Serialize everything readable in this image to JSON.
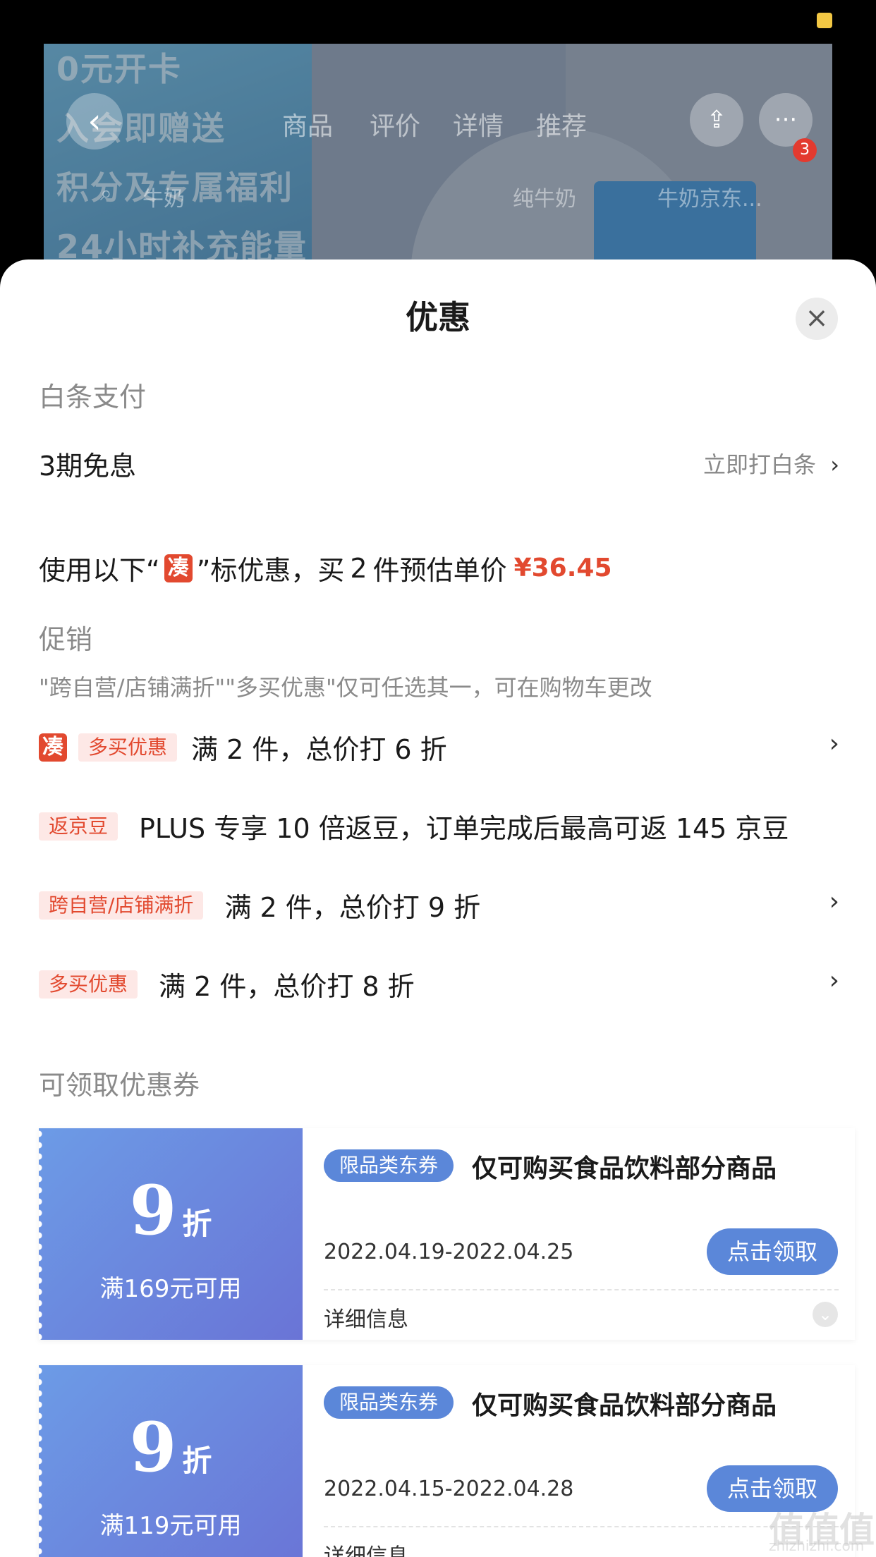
{
  "background": {
    "promo_lines": [
      "0元开卡",
      "入会即赠送",
      "积分及专属福利",
      "24小时补充能量"
    ],
    "tabs": [
      "商品",
      "评价",
      "详情",
      "推荐"
    ],
    "search_words": [
      "牛奶",
      "纯牛奶",
      "牛奶京东..."
    ],
    "more_badge": "3"
  },
  "sheet": {
    "title": "优惠",
    "close_icon": "close-icon",
    "baitiao": {
      "section_label": "白条支付",
      "plan": "3期免息",
      "action": "立即打白条"
    },
    "summary": {
      "prefix": "使用以下“",
      "tag": "凑",
      "middle": "”标优惠，买",
      "qty": "2",
      "suffix": "件预估单价",
      "price": "¥36.45"
    },
    "promotions": {
      "section_label": "促销",
      "note": "\"跨自营/店铺满折\"\"多买优惠\"仅可任选其一，可在购物车更改",
      "items": [
        {
          "cou": "凑",
          "tag": "多买优惠",
          "desc": "满 2 件，总价打 6 折",
          "has_arrow": true
        },
        {
          "tag": "返京豆",
          "desc": "PLUS 专享 10 倍返豆，订单完成后最高可返 145 京豆",
          "has_arrow": false
        },
        {
          "tag": "跨自营/店铺满折",
          "desc": "满 2 件，总价打 9 折",
          "has_arrow": true
        },
        {
          "tag": "多买优惠",
          "desc": "满 2 件，总价打 8 折",
          "has_arrow": true
        }
      ]
    },
    "coupons": {
      "section_label": "可领取优惠券",
      "items": [
        {
          "num": "9",
          "unit": "折",
          "condition": "满169元可用",
          "tag": "限品类东券",
          "title": "仅可购买食品饮料部分商品",
          "date": "2022.04.19-2022.04.25",
          "button": "点击领取",
          "detail": "详细信息"
        },
        {
          "num": "9",
          "unit": "折",
          "condition": "满119元可用",
          "tag": "限品类东券",
          "title": "仅可购买食品饮料部分商品",
          "date": "2022.04.15-2022.04.28",
          "button": "点击领取",
          "detail": "详细信息"
        }
      ]
    }
  },
  "watermark": {
    "text": "值值值",
    "sub": "zhizhizhi.com"
  },
  "colors": {
    "accent_red": "#e2492f",
    "coupon_blue": "#5b87d9"
  }
}
